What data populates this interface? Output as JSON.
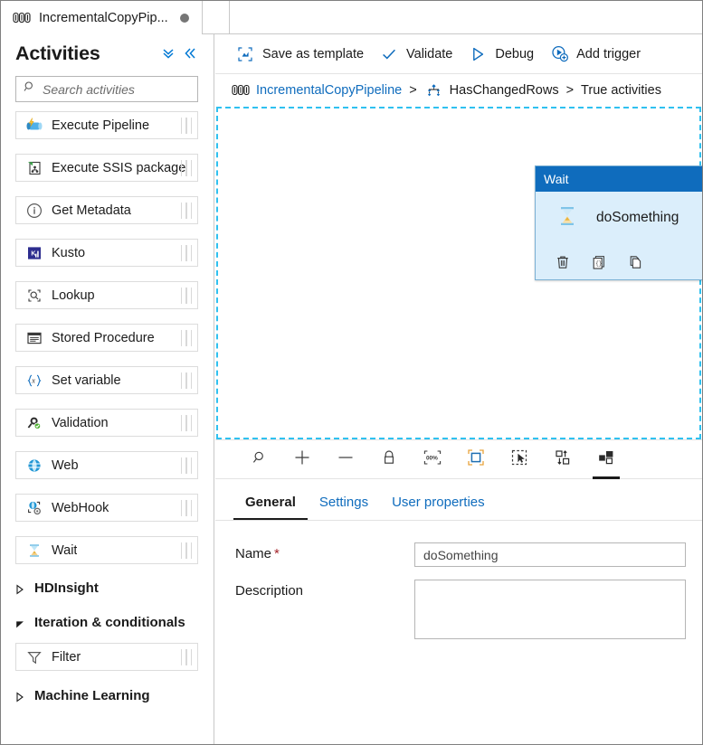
{
  "window": {
    "tab": {
      "title": "IncrementalCopyPip...",
      "icon": "pipeline-icon",
      "dirty_indicator": "unsaved-dot"
    }
  },
  "sidebar": {
    "title": "Activities",
    "header_buttons": [
      {
        "name": "expand-all-button",
        "icon": "double-chevron-down-icon"
      },
      {
        "name": "collapse-pane-button",
        "icon": "double-chevron-left-icon"
      }
    ],
    "search": {
      "placeholder": "Search activities",
      "value": "",
      "icon": "search-icon"
    },
    "activities": [
      {
        "label": "Execute Pipeline",
        "icon": "execute-pipeline-icon"
      },
      {
        "label": "Execute SSIS package",
        "icon": "execute-ssis-package-icon"
      },
      {
        "label": "Get Metadata",
        "icon": "get-metadata-icon"
      },
      {
        "label": "Kusto",
        "icon": "kusto-icon"
      },
      {
        "label": "Lookup",
        "icon": "lookup-icon"
      },
      {
        "label": "Stored Procedure",
        "icon": "stored-procedure-icon"
      },
      {
        "label": "Set variable",
        "icon": "set-variable-icon"
      },
      {
        "label": "Validation",
        "icon": "validation-icon"
      },
      {
        "label": "Web",
        "icon": "web-icon"
      },
      {
        "label": "WebHook",
        "icon": "webhook-icon"
      },
      {
        "label": "Wait",
        "icon": "wait-hourglass-icon"
      }
    ],
    "groups": [
      {
        "label": "HDInsight",
        "expanded": false
      },
      {
        "label": "Iteration & conditionals",
        "expanded": true
      },
      {
        "label": "Machine Learning",
        "expanded": false
      }
    ],
    "group_items": [
      {
        "label": "Filter",
        "icon": "filter-funnel-icon"
      }
    ]
  },
  "command_bar": {
    "items": [
      {
        "label": "Save as template",
        "icon": "save-as-template-icon"
      },
      {
        "label": "Validate",
        "icon": "checkmark-icon"
      },
      {
        "label": "Debug",
        "icon": "play-triangle-icon"
      },
      {
        "label": "Add trigger",
        "icon": "add-trigger-icon"
      }
    ]
  },
  "breadcrumb": {
    "pipeline": "IncrementalCopyPipeline",
    "sep1": ">",
    "condition": "HasChangedRows",
    "sep2": ">",
    "branch": "True activities"
  },
  "canvas": {
    "node": {
      "type": "Wait",
      "name": "doSomething",
      "icon": "wait-hourglass-icon",
      "tools": [
        {
          "name": "delete-activity-button",
          "icon": "trash-icon"
        },
        {
          "name": "code-view-button",
          "icon": "code-braces-icon"
        },
        {
          "name": "clone-activity-button",
          "icon": "copy-icon"
        },
        {
          "name": "add-next-activity-button",
          "icon": "add-arrow-icon"
        }
      ],
      "output_handle": "success-output-handle"
    },
    "toolbar": [
      {
        "name": "zoom-to-fit-button",
        "icon": "magnifier-icon"
      },
      {
        "name": "zoom-in-button",
        "icon": "plus-icon"
      },
      {
        "name": "zoom-out-button",
        "icon": "minus-icon"
      },
      {
        "name": "lock-canvas-button",
        "icon": "lock-icon"
      },
      {
        "name": "zoom-100-button",
        "icon": "zoom-100-percent-icon",
        "label": "100%"
      },
      {
        "name": "fit-to-screen-button",
        "icon": "fit-to-screen-icon"
      },
      {
        "name": "select-mode-button",
        "icon": "marquee-select-icon"
      },
      {
        "name": "auto-align-button",
        "icon": "auto-align-icon"
      },
      {
        "name": "layout-button",
        "icon": "layout-blocks-icon",
        "active": true
      }
    ]
  },
  "properties": {
    "tabs": [
      {
        "label": "General",
        "active": true
      },
      {
        "label": "Settings",
        "active": false
      },
      {
        "label": "User properties",
        "active": false
      }
    ],
    "fields": {
      "name": {
        "label": "Name",
        "required": "*",
        "value": "doSomething",
        "placeholder": ""
      },
      "description": {
        "label": "Description",
        "value": "",
        "placeholder": ""
      }
    }
  },
  "colors": {
    "accent": "#0f6cbd",
    "node_header": "#0f6cbd",
    "node_body": "#dbeefb",
    "canvas_dash": "#2fc1f0",
    "success_handle": "#4a8f4f",
    "required_red": "#a4262c"
  }
}
